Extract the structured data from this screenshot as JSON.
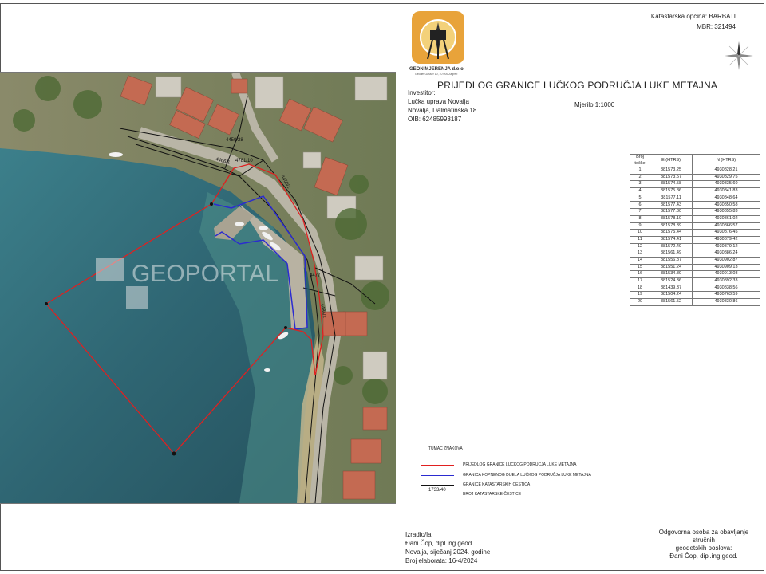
{
  "header": {
    "company": "GEON MJERENJA d.o.o.",
    "company_sub": "Geodet Gasser 10, 10 000 Zagreb",
    "cadastral_label": "Katastarska općina:",
    "cadastral_value": "BARBATI",
    "mbr_label": "MBR:",
    "mbr_value": "321494"
  },
  "title": "PRIJEDLOG GRANICE LUČKOG PODRUČJA LUKE METAJNA",
  "investor": {
    "label": "Investitor:",
    "name": "Lučka uprava Novalja",
    "address": "Novalja, Dalmatinska 18",
    "oib": "OIB: 62485993187"
  },
  "scale": "Mjerilo 1:1000",
  "table": {
    "headers": [
      "Broj točke",
      "E (HTRS)",
      "N (HTRS)"
    ],
    "rows": [
      [
        "1",
        "381573.25",
        "4930828.21"
      ],
      [
        "2",
        "381573.57",
        "4930829.75"
      ],
      [
        "3",
        "381574.58",
        "4930835.60"
      ],
      [
        "4",
        "381575.86",
        "4930841.83"
      ],
      [
        "5",
        "381577.11",
        "4930848.64"
      ],
      [
        "6",
        "381577.43",
        "4930850.58"
      ],
      [
        "7",
        "381577.80",
        "4930855.83"
      ],
      [
        "8",
        "381578.10",
        "4930861.02"
      ],
      [
        "9",
        "381578.39",
        "4930866.57"
      ],
      [
        "10",
        "381575.44",
        "4930876.45"
      ],
      [
        "11",
        "381574.41",
        "4930879.42"
      ],
      [
        "12",
        "381572.49",
        "4930879.12"
      ],
      [
        "13",
        "381561.49",
        "4930886.24"
      ],
      [
        "14",
        "381556.87",
        "4930902.87"
      ],
      [
        "15",
        "381551.24",
        "4930909.13"
      ],
      [
        "16",
        "381534.89",
        "4930913.08"
      ],
      [
        "17",
        "381524.36",
        "4930892.33"
      ],
      [
        "18",
        "381439.37",
        "4930838.56"
      ],
      [
        "19",
        "381504.24",
        "4930763.59"
      ],
      [
        "20",
        "381561.52",
        "4930830.86"
      ]
    ]
  },
  "legend": {
    "title": "TUMAČ ZNAKOVA",
    "items": [
      {
        "label": "PRIJEDLOG GRANICE LUČKOG PODRUČJA LUKE METAJNA",
        "color": "#e02020"
      },
      {
        "label": "GRANICA KOPNENOG DIJELA LUČKOG PODRUČJA LUKE METAJNA",
        "color": "#2b2bd0"
      },
      {
        "label": "GRANICE KATASTARSKIH ČESTICA",
        "color": "#111111"
      }
    ],
    "parcel_example": "1733/40",
    "parcel_label": "BROJ KATASTARSKE ČESTICE"
  },
  "map": {
    "watermark": "GEOPORTAL",
    "parcel_labels": [
      "4450/28",
      "4781/10",
      "4466/1",
      "4450/1",
      "4477",
      "4484/2"
    ]
  },
  "footer": {
    "prepared_label": "Izradio/la:",
    "prepared_name": "Đani Čop, dipl.ing.geod.",
    "date": "Novalja, siječanj 2024. godine",
    "elaborate": "Broj elaborata: 16-4/2024",
    "responsible_1": "Odgovorna osoba za obavljanje stručnih",
    "responsible_2": "geodetskih poslova:",
    "responsible_name": "Đani Čop, dipl.ing.geod."
  },
  "colors": {
    "boundary": "#e02020",
    "land_boundary": "#2b2bd0",
    "parcels": "#111111",
    "sea": "#2d5f6e"
  }
}
